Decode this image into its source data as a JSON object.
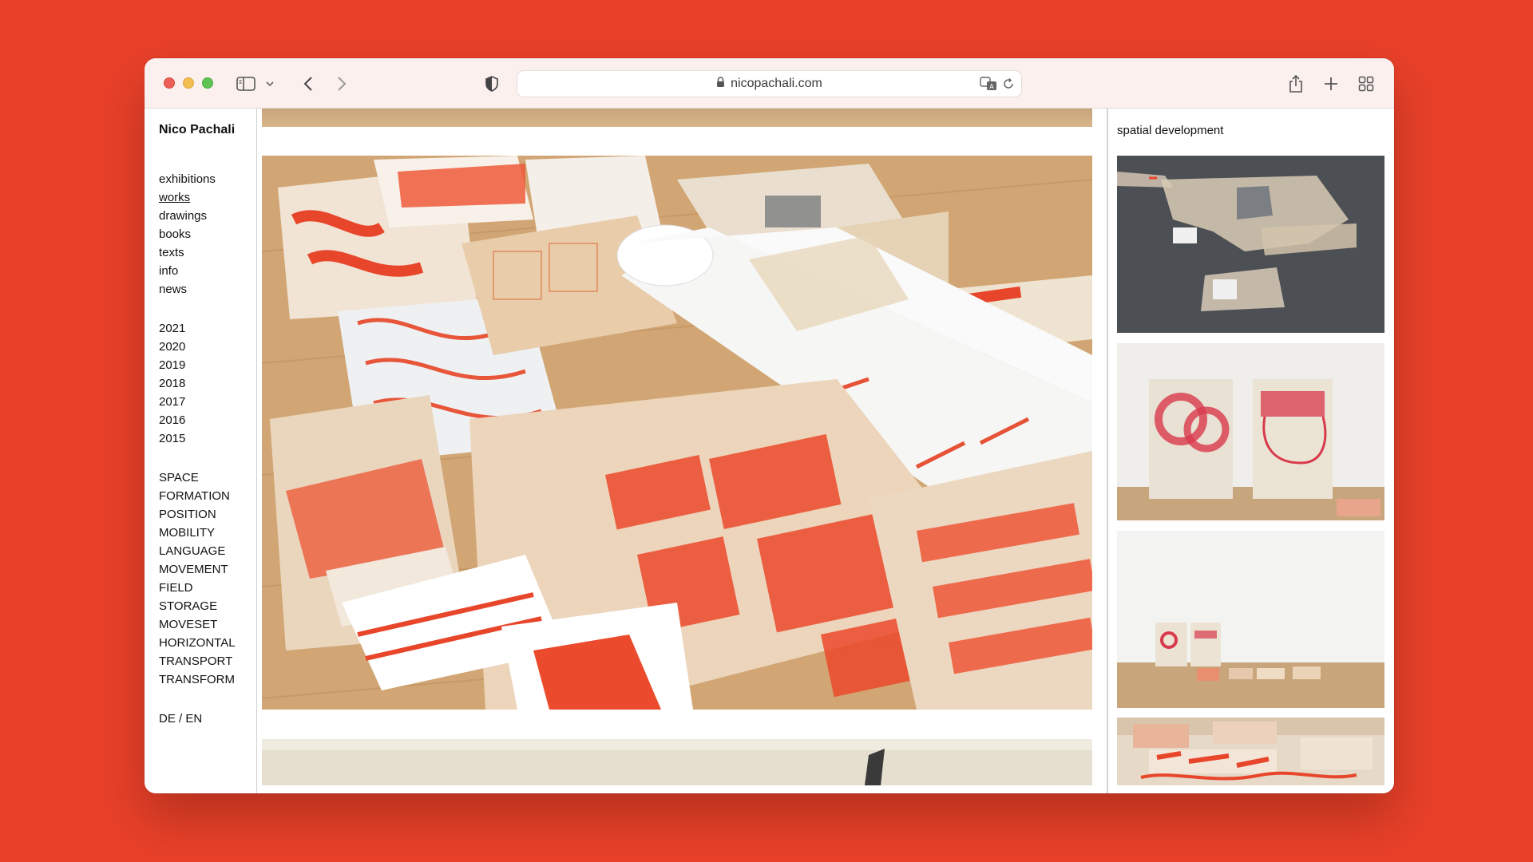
{
  "browser": {
    "url": "nicopachali.com",
    "icons": [
      "sidebar-icon",
      "chevron-down-icon",
      "back-icon",
      "forward-icon",
      "shield-icon",
      "lock-icon",
      "translate-icon",
      "reload-icon",
      "share-icon",
      "plus-icon",
      "tab-overview-icon"
    ]
  },
  "site": {
    "title": "Nico Pachali",
    "nav": [
      {
        "label": "exhibitions",
        "active": false
      },
      {
        "label": "works",
        "active": true
      },
      {
        "label": "drawings",
        "active": false
      },
      {
        "label": "books",
        "active": false
      },
      {
        "label": "texts",
        "active": false
      },
      {
        "label": "info",
        "active": false
      },
      {
        "label": "news",
        "active": false
      }
    ],
    "years": [
      "2021",
      "2020",
      "2019",
      "2018",
      "2017",
      "2016",
      "2015"
    ],
    "categories": [
      "SPACE",
      "FORMATION",
      "POSITION",
      "MOBILITY",
      "LANGUAGE",
      "MOVEMENT",
      "FIELD",
      "STORAGE",
      "MOVESET",
      "HORIZONTAL",
      "TRANSPORT",
      "TRANSFORM"
    ],
    "lang": {
      "de": "DE",
      "sep": "/",
      "en": "EN"
    }
  },
  "detail": {
    "section_title": "spatial development"
  },
  "colors": {
    "background": "#E8412A",
    "accent_red": "#E8412A",
    "toolbar": "#FBF0EE"
  }
}
